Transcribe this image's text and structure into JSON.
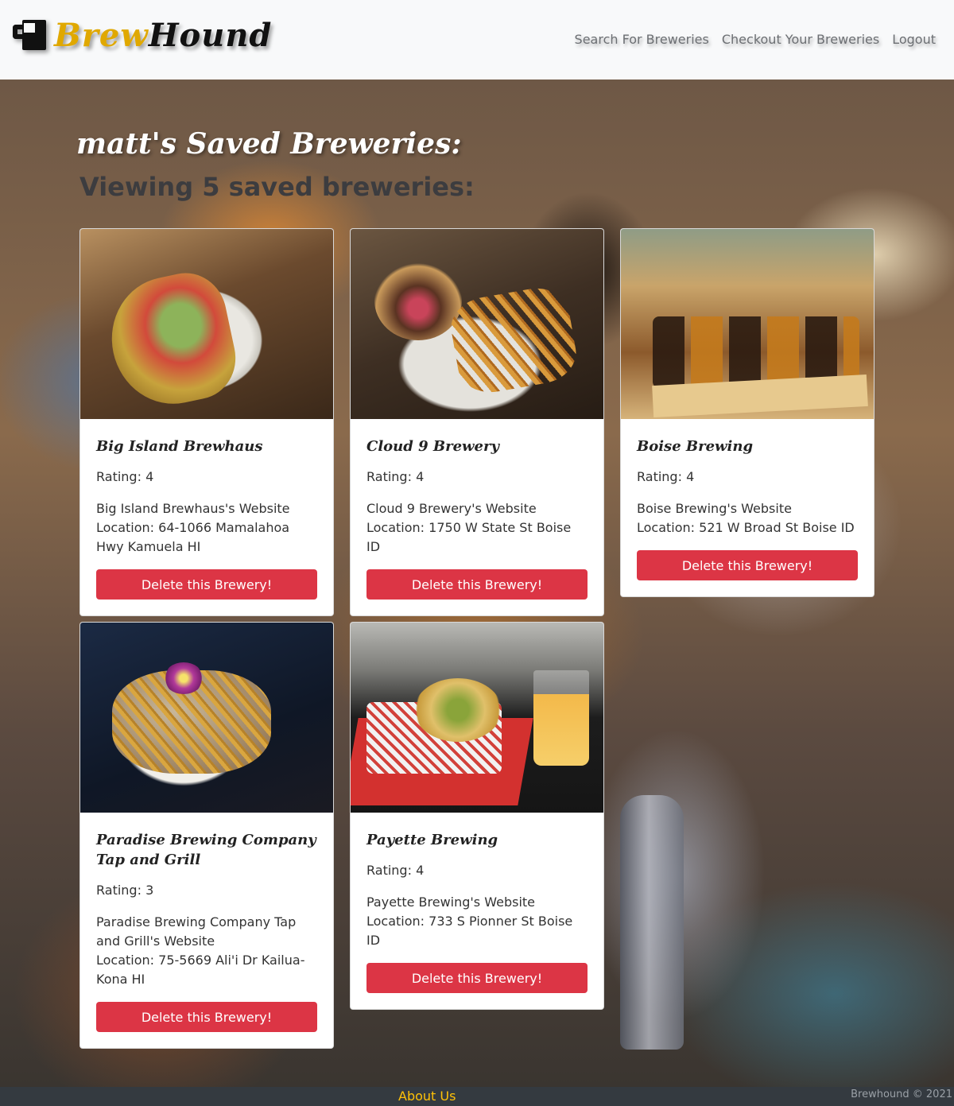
{
  "navbar": {
    "brand_part1": "Brew",
    "brand_part2": "Hound",
    "brand_icon": "beer-mug-icon",
    "links": [
      "Search For Breweries",
      "Checkout Your Breweries",
      "Logout"
    ]
  },
  "page": {
    "title": "matt's Saved Breweries:",
    "subtitle": "Viewing 5 saved breweries:"
  },
  "breweries": [
    {
      "name": "Big Island Brewhaus",
      "rating": "Rating: 4",
      "website": "Big Island Brewhaus's Website",
      "location": "Location: 64-1066 Mamalahoa Hwy Kamuela HI",
      "delete_label": "Delete this Brewery!"
    },
    {
      "name": "Cloud 9 Brewery",
      "rating": "Rating: 4",
      "website": "Cloud 9 Brewery's Website",
      "location": "Location: 1750 W State St Boise ID",
      "delete_label": "Delete this Brewery!"
    },
    {
      "name": "Boise Brewing",
      "rating": "Rating: 4",
      "website": "Boise Brewing's Website",
      "location": "Location: 521 W Broad St Boise ID",
      "delete_label": "Delete this Brewery!"
    },
    {
      "name": "Paradise Brewing Company Tap and Grill",
      "rating": "Rating: 3",
      "website": "Paradise Brewing Company Tap and Grill's Website",
      "location": "Location: 75-5669 Ali'i Dr Kailua-Kona HI",
      "delete_label": "Delete this Brewery!"
    },
    {
      "name": "Payette Brewing",
      "rating": "Rating: 4",
      "website": "Payette Brewing's Website",
      "location": "Location: 733 S Pionner St Boise ID",
      "delete_label": "Delete this Brewery!"
    }
  ],
  "footer": {
    "about": "About Us",
    "copyright": "Brewhound © 2021"
  },
  "colors": {
    "navbar_bg": "#f8f9fa",
    "brand_gold": "#e0a800",
    "delete_button": "#dc3545",
    "footer_bg": "#343a40",
    "footer_link": "#ffc107"
  }
}
